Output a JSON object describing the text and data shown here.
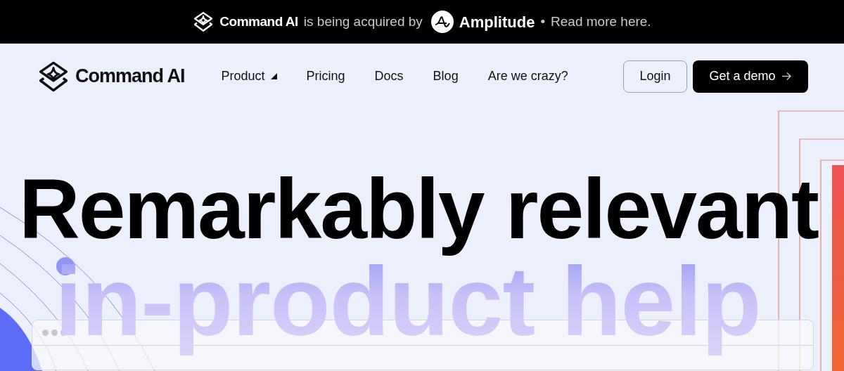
{
  "announcement": {
    "brand": "Command AI",
    "text": "is being acquired by",
    "partner": "Amplitude",
    "separator": "•",
    "link": "Read more here."
  },
  "navbar": {
    "brand": "Command AI",
    "items": [
      {
        "label": "Product",
        "kind": "dropdown"
      },
      {
        "label": "Pricing",
        "kind": "link"
      },
      {
        "label": "Docs",
        "kind": "link"
      },
      {
        "label": "Blog",
        "kind": "link"
      },
      {
        "label": "Are we crazy?",
        "kind": "link"
      }
    ],
    "login": "Login",
    "cta": "Get a demo"
  },
  "hero": {
    "headline": "Remarkably relevant",
    "subheadline": "in-product help"
  }
}
